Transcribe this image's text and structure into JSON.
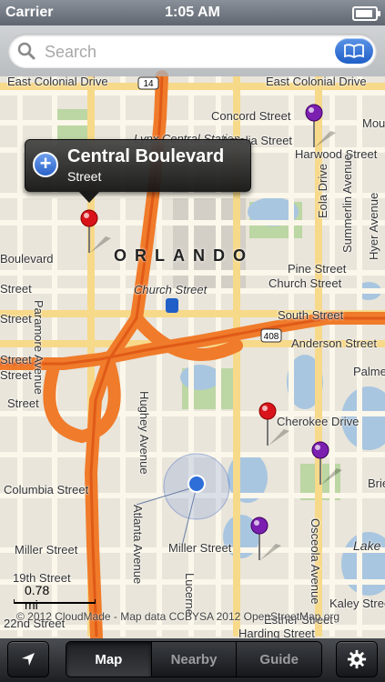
{
  "status_bar": {
    "carrier": "Carrier",
    "time": "1:05 AM",
    "battery_level": 0.9
  },
  "search": {
    "placeholder": "Search",
    "value": ""
  },
  "map": {
    "city_label": "ORLANDO",
    "street_labels": [
      "East Colonial Drive",
      "East Colonial Drive",
      "Lynx Central Station",
      "Concord Street",
      "Amelia Street",
      "Harwood Street",
      "Mou",
      "Boulevard",
      "Paramore Avenue",
      "Pine Street",
      "Church Street",
      "Church Street",
      "South Street",
      "Anderson Street",
      "Palme",
      "Cherokee Drive",
      "Eola Drive",
      "Summerlin Avenue",
      "Hyer Avenue",
      "Columbia Street",
      "Hughey Avenue",
      "Atlanta Avenue",
      "Miller Street",
      "Miller Street",
      "Lucerne",
      "Osceola Avenue",
      "Brie",
      "Lake",
      "19th Street",
      "22nd Street",
      "Kaley Street",
      "Esther Street",
      "Harding Street",
      "Street",
      "Street",
      "Street",
      "Street",
      "Street"
    ],
    "highway_shields": [
      "408",
      "14"
    ],
    "callout": {
      "title": "Central Boulevard",
      "subtitle": "Street"
    },
    "scale_label": "0.78 mi",
    "attribution": "© 2012 CloudMade - Map data CCBYSA 2012 OpenStreetMap.org",
    "colors": {
      "pin_red": "#d8141a",
      "pin_purple": "#7a1fb0",
      "highway": "#f07b2a",
      "road": "#fbf7ea",
      "water": "#a9c6e0",
      "park": "#bcd6a4"
    }
  },
  "toolbar": {
    "locate_icon": "location-arrow-icon",
    "tabs": [
      {
        "label": "Map",
        "active": true
      },
      {
        "label": "Nearby",
        "active": false
      },
      {
        "label": "Guide",
        "active": false
      }
    ],
    "settings_icon": "gear-icon"
  }
}
